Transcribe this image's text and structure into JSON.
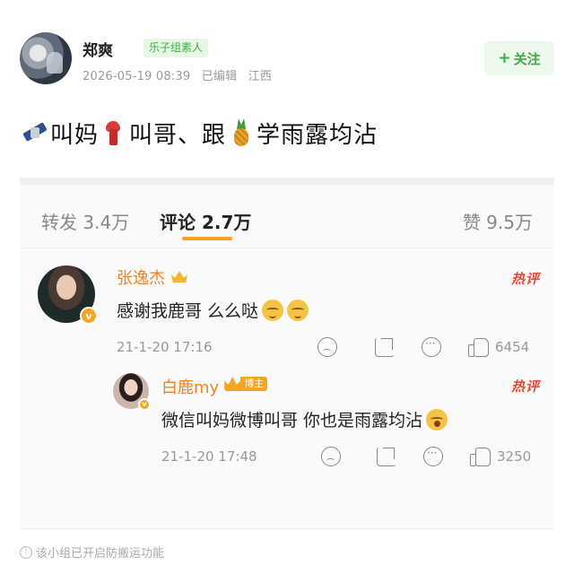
{
  "post": {
    "author": "郑爽",
    "group_badge": "乐子组素人",
    "date": "2026-05-19 08:39",
    "edited": "已编辑",
    "location": "江西",
    "follow_plus": "+",
    "follow_label": "关注",
    "text_segments": [
      "叫妈",
      "叫哥、跟",
      "学雨露均沾"
    ],
    "emoji_names": [
      "satellite-icon",
      "scarf-icon",
      "pineapple-icon"
    ]
  },
  "stats": {
    "repost": "转发 3.4万",
    "comment": "评论 2.7万",
    "like": "赞 9.5万",
    "active_tab": "comment",
    "accent_color": "#f7a21b"
  },
  "comments": [
    {
      "name": "张逸杰",
      "hot": "热评",
      "text": "感谢我鹿哥 么么哒",
      "time": "21-1-20 17:16",
      "likes": "6454",
      "name_color": "#f4801f"
    },
    {
      "name": "白鹿my",
      "badge": "博主",
      "hot": "热评",
      "text": "微信叫妈微博叫哥 你也是雨露均沾",
      "time": "21-1-20 17:48",
      "likes": "3250"
    }
  ],
  "footer": {
    "notice": "该小组已开启防搬运功能"
  },
  "colors": {
    "green": "#3bab42",
    "hot_red": "#e8483a",
    "verified_orange": "#f6a623"
  }
}
